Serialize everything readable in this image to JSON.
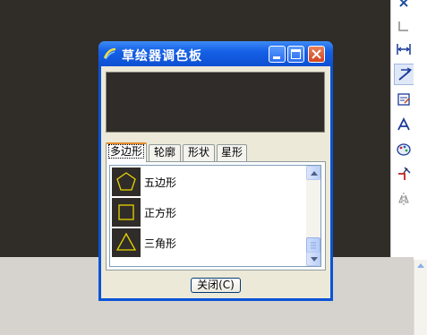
{
  "dialog": {
    "title": "草绘器调色板",
    "tabs": [
      "多边形",
      "轮廓",
      "形状",
      "星形"
    ],
    "active_tab": "多边形",
    "items": [
      {
        "label": "五边形",
        "icon": "pentagon-icon"
      },
      {
        "label": "正方形",
        "icon": "square-icon"
      },
      {
        "label": "三角形",
        "icon": "triangle-icon"
      }
    ],
    "close_label": "关闭(C)"
  },
  "colors": {
    "titlebar": "#0c50d2",
    "shape_stroke": "#e8d400",
    "canvas": "#302d29",
    "active_tab_accent": "#e68b2c"
  },
  "toolbar": {
    "icons": [
      "close-x-icon",
      "corner-icon",
      "dimension-icon",
      "sketch-line-icon",
      "modify-icon",
      "text-icon",
      "palette-icon",
      "trim-icon",
      "mirror-icon"
    ]
  }
}
